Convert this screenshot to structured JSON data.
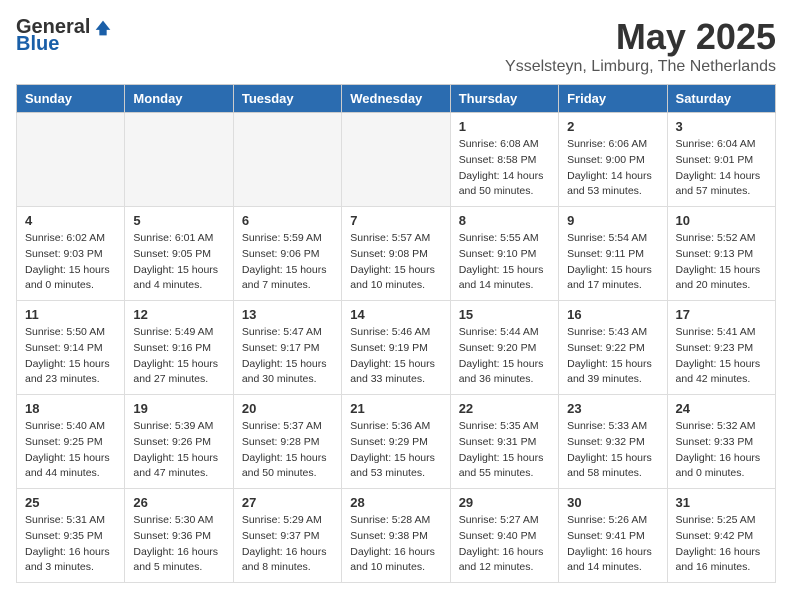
{
  "header": {
    "logo_general": "General",
    "logo_blue": "Blue",
    "month_title": "May 2025",
    "subtitle": "Ysselsteyn, Limburg, The Netherlands"
  },
  "weekdays": [
    "Sunday",
    "Monday",
    "Tuesday",
    "Wednesday",
    "Thursday",
    "Friday",
    "Saturday"
  ],
  "weeks": [
    [
      {
        "day": "",
        "info": ""
      },
      {
        "day": "",
        "info": ""
      },
      {
        "day": "",
        "info": ""
      },
      {
        "day": "",
        "info": ""
      },
      {
        "day": "1",
        "info": "Sunrise: 6:08 AM\nSunset: 8:58 PM\nDaylight: 14 hours\nand 50 minutes."
      },
      {
        "day": "2",
        "info": "Sunrise: 6:06 AM\nSunset: 9:00 PM\nDaylight: 14 hours\nand 53 minutes."
      },
      {
        "day": "3",
        "info": "Sunrise: 6:04 AM\nSunset: 9:01 PM\nDaylight: 14 hours\nand 57 minutes."
      }
    ],
    [
      {
        "day": "4",
        "info": "Sunrise: 6:02 AM\nSunset: 9:03 PM\nDaylight: 15 hours\nand 0 minutes."
      },
      {
        "day": "5",
        "info": "Sunrise: 6:01 AM\nSunset: 9:05 PM\nDaylight: 15 hours\nand 4 minutes."
      },
      {
        "day": "6",
        "info": "Sunrise: 5:59 AM\nSunset: 9:06 PM\nDaylight: 15 hours\nand 7 minutes."
      },
      {
        "day": "7",
        "info": "Sunrise: 5:57 AM\nSunset: 9:08 PM\nDaylight: 15 hours\nand 10 minutes."
      },
      {
        "day": "8",
        "info": "Sunrise: 5:55 AM\nSunset: 9:10 PM\nDaylight: 15 hours\nand 14 minutes."
      },
      {
        "day": "9",
        "info": "Sunrise: 5:54 AM\nSunset: 9:11 PM\nDaylight: 15 hours\nand 17 minutes."
      },
      {
        "day": "10",
        "info": "Sunrise: 5:52 AM\nSunset: 9:13 PM\nDaylight: 15 hours\nand 20 minutes."
      }
    ],
    [
      {
        "day": "11",
        "info": "Sunrise: 5:50 AM\nSunset: 9:14 PM\nDaylight: 15 hours\nand 23 minutes."
      },
      {
        "day": "12",
        "info": "Sunrise: 5:49 AM\nSunset: 9:16 PM\nDaylight: 15 hours\nand 27 minutes."
      },
      {
        "day": "13",
        "info": "Sunrise: 5:47 AM\nSunset: 9:17 PM\nDaylight: 15 hours\nand 30 minutes."
      },
      {
        "day": "14",
        "info": "Sunrise: 5:46 AM\nSunset: 9:19 PM\nDaylight: 15 hours\nand 33 minutes."
      },
      {
        "day": "15",
        "info": "Sunrise: 5:44 AM\nSunset: 9:20 PM\nDaylight: 15 hours\nand 36 minutes."
      },
      {
        "day": "16",
        "info": "Sunrise: 5:43 AM\nSunset: 9:22 PM\nDaylight: 15 hours\nand 39 minutes."
      },
      {
        "day": "17",
        "info": "Sunrise: 5:41 AM\nSunset: 9:23 PM\nDaylight: 15 hours\nand 42 minutes."
      }
    ],
    [
      {
        "day": "18",
        "info": "Sunrise: 5:40 AM\nSunset: 9:25 PM\nDaylight: 15 hours\nand 44 minutes."
      },
      {
        "day": "19",
        "info": "Sunrise: 5:39 AM\nSunset: 9:26 PM\nDaylight: 15 hours\nand 47 minutes."
      },
      {
        "day": "20",
        "info": "Sunrise: 5:37 AM\nSunset: 9:28 PM\nDaylight: 15 hours\nand 50 minutes."
      },
      {
        "day": "21",
        "info": "Sunrise: 5:36 AM\nSunset: 9:29 PM\nDaylight: 15 hours\nand 53 minutes."
      },
      {
        "day": "22",
        "info": "Sunrise: 5:35 AM\nSunset: 9:31 PM\nDaylight: 15 hours\nand 55 minutes."
      },
      {
        "day": "23",
        "info": "Sunrise: 5:33 AM\nSunset: 9:32 PM\nDaylight: 15 hours\nand 58 minutes."
      },
      {
        "day": "24",
        "info": "Sunrise: 5:32 AM\nSunset: 9:33 PM\nDaylight: 16 hours\nand 0 minutes."
      }
    ],
    [
      {
        "day": "25",
        "info": "Sunrise: 5:31 AM\nSunset: 9:35 PM\nDaylight: 16 hours\nand 3 minutes."
      },
      {
        "day": "26",
        "info": "Sunrise: 5:30 AM\nSunset: 9:36 PM\nDaylight: 16 hours\nand 5 minutes."
      },
      {
        "day": "27",
        "info": "Sunrise: 5:29 AM\nSunset: 9:37 PM\nDaylight: 16 hours\nand 8 minutes."
      },
      {
        "day": "28",
        "info": "Sunrise: 5:28 AM\nSunset: 9:38 PM\nDaylight: 16 hours\nand 10 minutes."
      },
      {
        "day": "29",
        "info": "Sunrise: 5:27 AM\nSunset: 9:40 PM\nDaylight: 16 hours\nand 12 minutes."
      },
      {
        "day": "30",
        "info": "Sunrise: 5:26 AM\nSunset: 9:41 PM\nDaylight: 16 hours\nand 14 minutes."
      },
      {
        "day": "31",
        "info": "Sunrise: 5:25 AM\nSunset: 9:42 PM\nDaylight: 16 hours\nand 16 minutes."
      }
    ]
  ]
}
